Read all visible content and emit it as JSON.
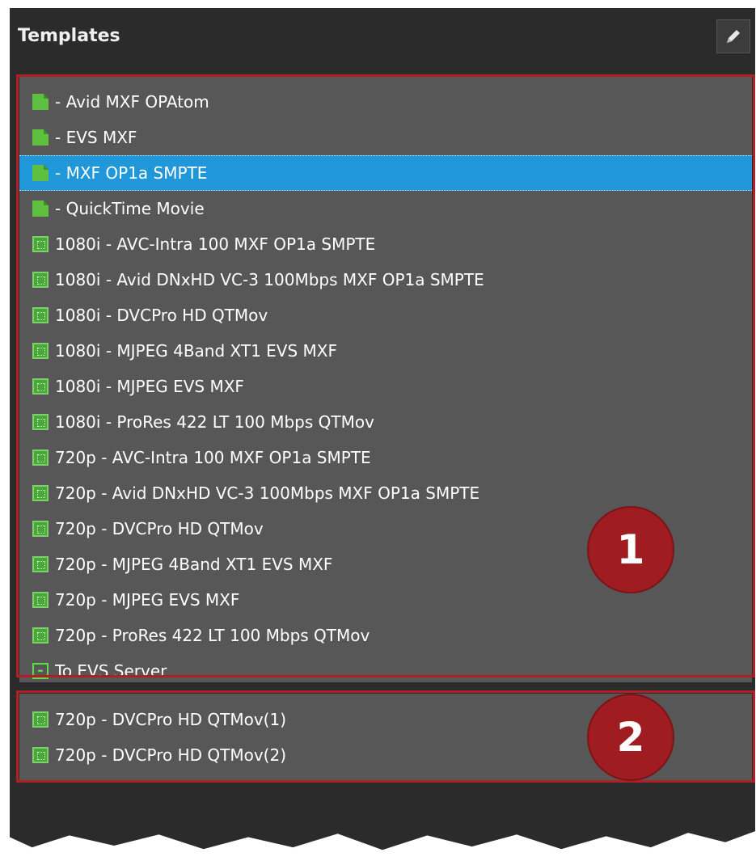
{
  "panel": {
    "title": "Templates",
    "edit_icon": "pencil-icon"
  },
  "group1": {
    "badge": "1",
    "items": [
      {
        "label": "- Avid MXF OPAtom",
        "icon": "document-icon",
        "selected": false
      },
      {
        "label": "- EVS MXF",
        "icon": "document-icon",
        "selected": false
      },
      {
        "label": "- MXF OP1a SMPTE",
        "icon": "document-icon",
        "selected": true
      },
      {
        "label": "- QuickTime Movie",
        "icon": "document-icon",
        "selected": false
      },
      {
        "label": "1080i - AVC-Intra 100 MXF OP1a SMPTE",
        "icon": "chip-icon",
        "selected": false
      },
      {
        "label": "1080i - Avid DNxHD VC-3 100Mbps MXF OP1a SMPTE",
        "icon": "chip-icon",
        "selected": false
      },
      {
        "label": "1080i - DVCPro HD QTMov",
        "icon": "chip-icon",
        "selected": false
      },
      {
        "label": "1080i - MJPEG 4Band XT1 EVS MXF",
        "icon": "chip-icon",
        "selected": false
      },
      {
        "label": "1080i - MJPEG EVS MXF",
        "icon": "chip-icon",
        "selected": false
      },
      {
        "label": "1080i - ProRes 422 LT 100 Mbps QTMov",
        "icon": "chip-icon",
        "selected": false
      },
      {
        "label": "720p - AVC-Intra 100 MXF OP1a SMPTE",
        "icon": "chip-icon",
        "selected": false
      },
      {
        "label": "720p - Avid DNxHD VC-3 100Mbps MXF OP1a SMPTE",
        "icon": "chip-icon",
        "selected": false
      },
      {
        "label": "720p - DVCPro HD QTMov",
        "icon": "chip-icon",
        "selected": false
      },
      {
        "label": "720p - MJPEG 4Band XT1 EVS MXF",
        "icon": "chip-icon",
        "selected": false
      },
      {
        "label": "720p - MJPEG EVS MXF",
        "icon": "chip-icon",
        "selected": false
      },
      {
        "label": "720p - ProRes 422 LT 100 Mbps QTMov",
        "icon": "chip-icon",
        "selected": false
      },
      {
        "label": "To EVS Server",
        "icon": "server-icon",
        "selected": false
      }
    ]
  },
  "group2": {
    "badge": "2",
    "items": [
      {
        "label": "720p - DVCPro HD QTMov(1)",
        "icon": "chip-icon",
        "selected": false
      },
      {
        "label": "720p - DVCPro HD QTMov(2)",
        "icon": "chip-icon",
        "selected": false
      }
    ]
  },
  "colors": {
    "panel_bg": "#2b2b2b",
    "list_bg": "#575757",
    "selection": "#1f97d8",
    "annotation_red": "#b01f24",
    "icon_green": "#5fbf3f"
  }
}
